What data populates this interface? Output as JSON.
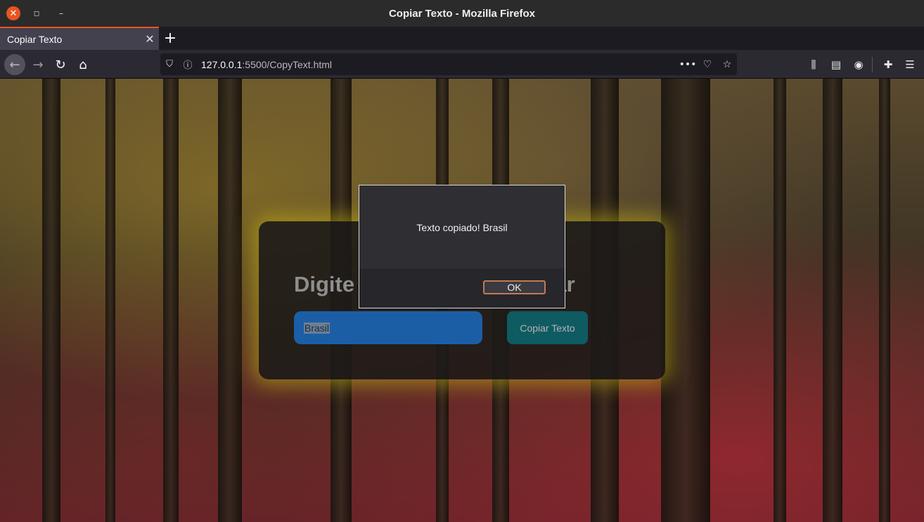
{
  "window": {
    "title": "Copiar Texto - Mozilla Firefox",
    "close_glyph": "✕",
    "restore_glyph": "◻",
    "minimize_glyph": "–"
  },
  "tabs": [
    {
      "title": "Copiar Texto",
      "close_glyph": "✕"
    }
  ],
  "new_tab_glyph": "+",
  "nav": {
    "back_glyph": "←",
    "forward_glyph": "→",
    "reload_glyph": "↻",
    "home_glyph": "⌂"
  },
  "urlbar": {
    "url_host": "127.0.0.1",
    "url_rest": ":5500/CopyText.html",
    "shield_glyph": "⛉",
    "info_glyph": "ⓘ",
    "more_glyph": "•••",
    "pocket_glyph": "♡",
    "star_glyph": "☆"
  },
  "toolbar": {
    "library_glyph": "⫼",
    "sidebar_glyph": "▤",
    "account_glyph": "◉",
    "extensions_glyph": "✚",
    "menu_glyph": "☰"
  },
  "page": {
    "heading": "Digite um texto para copiar",
    "input_value": "Brasil",
    "copy_button": "Copiar Texto"
  },
  "dialog": {
    "message": "Texto copiado! Brasil",
    "ok_label": "OK"
  },
  "colors": {
    "accent": "#e95420",
    "card_glow": "#c8b414",
    "input_bg": "#1c5ea6",
    "button_bg": "#0f5b62"
  }
}
